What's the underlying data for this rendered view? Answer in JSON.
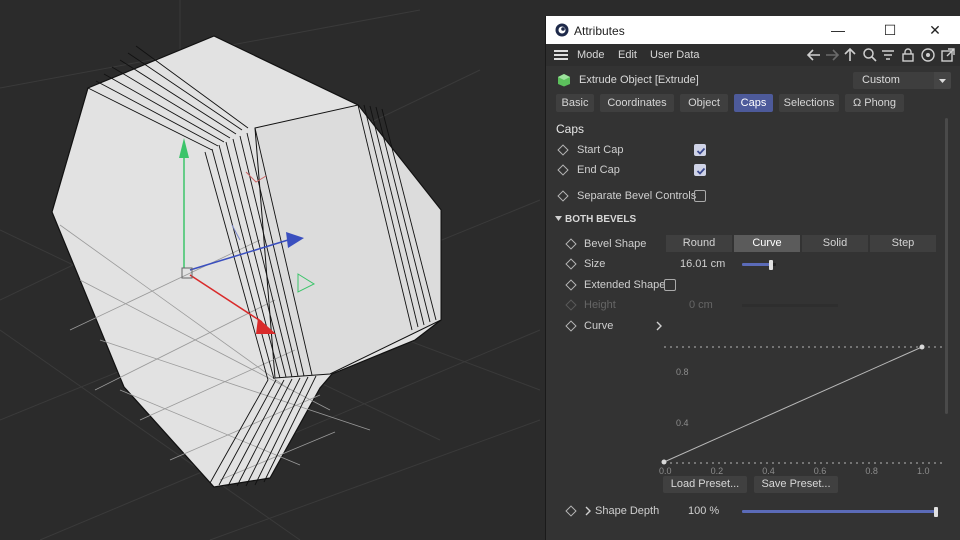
{
  "window": {
    "title": "Attributes",
    "controls": {
      "minimize": "—",
      "maximize": "☐",
      "close": "✕"
    }
  },
  "menu": {
    "items": [
      "Mode",
      "Edit",
      "User Data"
    ]
  },
  "object": {
    "title": "Extrude Object [Extrude]",
    "preset": "Custom"
  },
  "tabs": [
    {
      "label": "Basic",
      "active": false
    },
    {
      "label": "Coordinates",
      "active": false
    },
    {
      "label": "Object",
      "active": false
    },
    {
      "label": "Caps",
      "active": true
    },
    {
      "label": "Selections",
      "active": false
    },
    {
      "label": "Ω Phong",
      "active": false
    }
  ],
  "caps": {
    "section_title": "Caps",
    "start_cap": {
      "label": "Start Cap",
      "checked": true
    },
    "end_cap": {
      "label": "End Cap",
      "checked": true
    },
    "separate_bevel": {
      "label": "Separate Bevel Controls",
      "checked": false
    }
  },
  "both_bevels": {
    "title": "BOTH BEVELS",
    "bevel_shape": {
      "label": "Bevel Shape",
      "options": [
        "Round",
        "Curve",
        "Solid",
        "Step"
      ],
      "selected": "Curve"
    },
    "size": {
      "label": "Size",
      "value": "16.01 cm",
      "slider_fraction": 0.9
    },
    "extended_shape": {
      "label": "Extended Shape",
      "checked": false
    },
    "height": {
      "label": "Height",
      "value": "0 cm",
      "enabled": false
    },
    "curve": {
      "label": "Curve"
    },
    "curve_graph": {
      "y_ticks": [
        "0.8",
        "0.4"
      ],
      "x_ticks": [
        "0.0",
        "0.2",
        "0.4",
        "0.6",
        "0.8",
        "1.0"
      ],
      "points": [
        [
          0,
          0
        ],
        [
          1,
          1
        ]
      ]
    },
    "load_preset": "Load Preset...",
    "save_preset": "Save Preset...",
    "shape_depth": {
      "label": "Shape Depth",
      "value": "100 %",
      "slider_fraction": 1.0
    }
  },
  "colors": {
    "accent": "#4d5a9a",
    "slider": "#5b6bb8",
    "gizmo_y": "#3cc46a",
    "gizmo_x": "#d92b2b",
    "gizmo_z": "#3a4fbf"
  }
}
